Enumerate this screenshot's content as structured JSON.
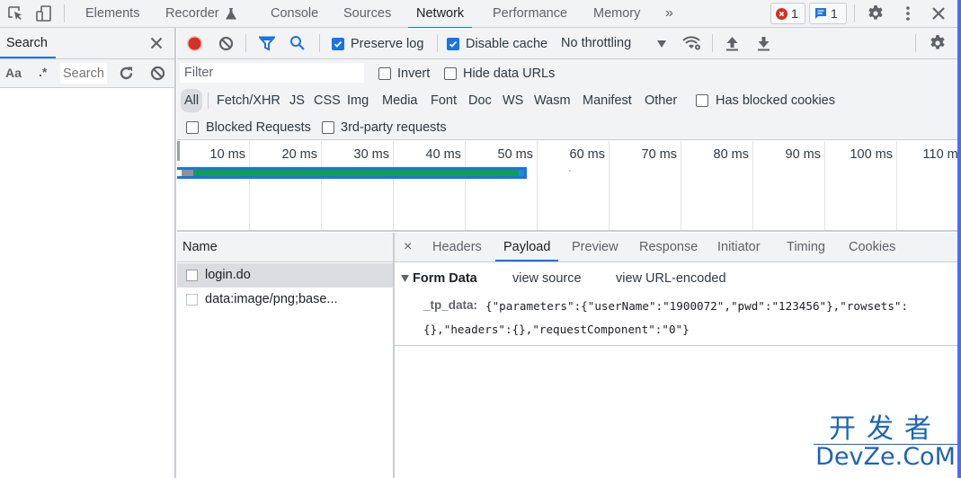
{
  "devtools": {
    "top_tabs": [
      {
        "label": "Elements"
      },
      {
        "label": "Recorder"
      },
      {
        "label": "Console"
      },
      {
        "label": "Sources"
      },
      {
        "label": "Network",
        "active": true
      },
      {
        "label": "Performance"
      },
      {
        "label": "Memory"
      }
    ],
    "more_tabs_glyph": "»",
    "error_count": "1",
    "message_count": "1",
    "colors": {
      "accent": "#1a73e8",
      "record_red": "#d93025",
      "error_red": "#d93025",
      "timeline_green": "#0f9d58",
      "timeline_blue": "#1a73e8",
      "toolbar_bg": "#f1f3f4"
    }
  },
  "search_pane": {
    "title": "Search",
    "match_case_label": "Aa",
    "regex_label": ".*",
    "search_placeholder": "Search"
  },
  "network_toolbar": {
    "preserve_log": {
      "label": "Preserve log",
      "checked": true
    },
    "disable_cache": {
      "label": "Disable cache",
      "checked": true
    },
    "throttling": "No throttling"
  },
  "filter": {
    "placeholder": "Filter",
    "invert_label": "Invert",
    "hide_data_urls_label": "Hide data URLs",
    "types": [
      "All",
      "Fetch/XHR",
      "JS",
      "CSS",
      "Img",
      "Media",
      "Font",
      "Doc",
      "WS",
      "Wasm",
      "Manifest",
      "Other"
    ],
    "active_type": "All",
    "has_blocked_cookies_label": "Has blocked cookies",
    "blocked_requests_label": "Blocked Requests",
    "third_party_label": "3rd-party requests"
  },
  "overview": {
    "ticks": [
      "10 ms",
      "20 ms",
      "30 ms",
      "40 ms",
      "50 ms",
      "60 ms",
      "70 ms",
      "80 ms",
      "90 ms",
      "100 ms",
      "110 ms"
    ],
    "request_bar": {
      "start_ms": 0,
      "waiting_start_ms": 2,
      "download_start_ms": 47.5,
      "end_ms": 48.5
    }
  },
  "requests": {
    "column_name": "Name",
    "rows": [
      {
        "name": "login.do",
        "selected": true
      },
      {
        "name": "data:image/png;base...",
        "selected": false
      }
    ]
  },
  "details": {
    "close_glyph": "×",
    "tabs": [
      {
        "label": "Headers"
      },
      {
        "label": "Payload",
        "active": true
      },
      {
        "label": "Preview"
      },
      {
        "label": "Response"
      },
      {
        "label": "Initiator"
      },
      {
        "label": "Timing"
      },
      {
        "label": "Cookies"
      }
    ],
    "form_data": {
      "title": "Form Data",
      "view_source": "view source",
      "view_url_encoded": "view URL-encoded",
      "key": "_tp_data:",
      "value_line1": "{\"parameters\":{\"userName\":\"1900072\",\"pwd\":\"123456\"},\"rowsets\":",
      "value_line2": "{},\"headers\":{},\"requestComponent\":\"0\"}"
    }
  },
  "watermark": {
    "cn": "开发者",
    "en": "DevZe.CoM"
  }
}
